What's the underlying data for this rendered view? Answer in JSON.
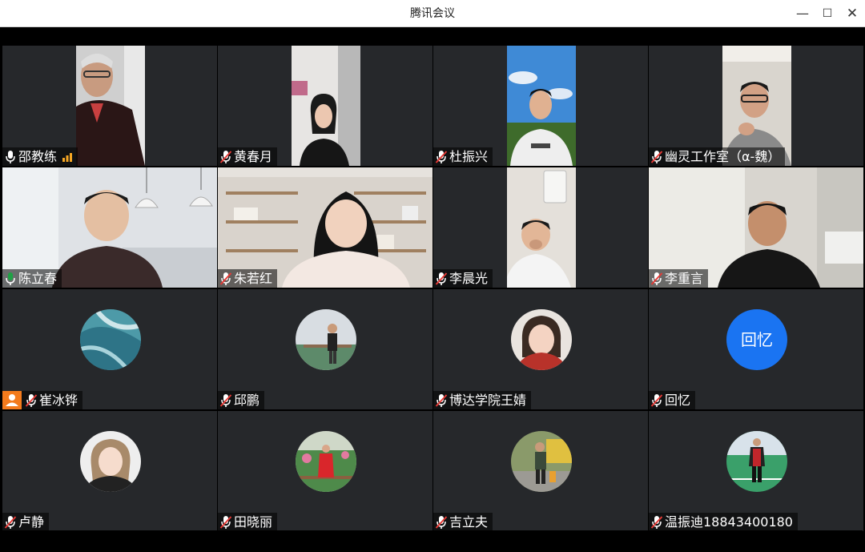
{
  "window": {
    "title": "腾讯会议",
    "minimize": "—",
    "maximize": "☐",
    "close": "✕"
  },
  "participants": [
    {
      "name": "邵教练",
      "mic": "on",
      "speaking": true
    },
    {
      "name": "黄春月",
      "mic": "muted"
    },
    {
      "name": "杜振兴",
      "mic": "muted"
    },
    {
      "name": "幽灵工作室（α-魏）",
      "mic": "muted"
    },
    {
      "name": "陈立春",
      "mic": "on",
      "active": true
    },
    {
      "name": "朱若红",
      "mic": "muted"
    },
    {
      "name": "李晨光",
      "mic": "muted"
    },
    {
      "name": "李重言",
      "mic": "muted"
    },
    {
      "name": "崔冰铧",
      "mic": "muted",
      "host": true
    },
    {
      "name": "邱鹏",
      "mic": "muted"
    },
    {
      "name": "博达学院王婧",
      "mic": "muted"
    },
    {
      "name": "回忆",
      "mic": "muted",
      "avatar_text": "回忆"
    },
    {
      "name": "卢静",
      "mic": "muted"
    },
    {
      "name": "田晓丽",
      "mic": "muted"
    },
    {
      "name": "吉立夫",
      "mic": "muted"
    },
    {
      "name": "温振迪18843400180",
      "mic": "muted"
    }
  ],
  "colors": {
    "tile_bg": "#26282b",
    "mic_on": "#1fa145",
    "mic_muted": "#e53935",
    "avatar_blue": "#1a74f2",
    "host_badge": "#f37b1d"
  }
}
